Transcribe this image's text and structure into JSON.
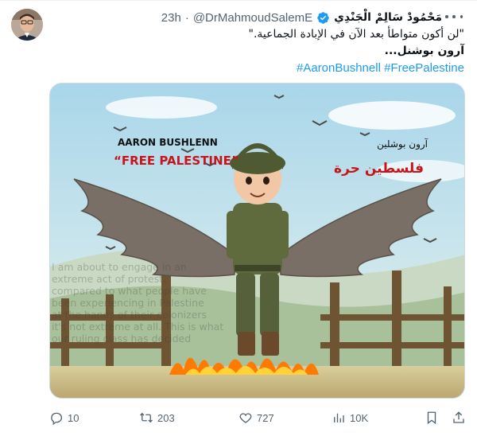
{
  "tweet": {
    "display_name": "مَحْمُودْ سَالِمْ الْجَنْدِي",
    "handle": "@DrMahmoudSalemE",
    "separator": "·",
    "time": "23h",
    "text_line1": "\"لن أكون متواطأ بعد الآن في الإبادة الجماعية.\"",
    "text_line2": "آرون بوشنل...",
    "hashtag1": "#FreePalestine",
    "hashtag2": "#AaronBushnell"
  },
  "image": {
    "english_name": "AARON BUSHLENN",
    "english_slogan": "“FREE   PALESTINE”",
    "arabic_name": "آرون بوشلين",
    "arabic_slogan": "فلسطين حرة",
    "overlay_text": [
      "I am about to engage in an",
      "extreme act of protest.",
      "compared to what people have",
      "been experiencing in Palestine",
      "at the hands of their colonizers",
      "it's not extreme at all. This is what",
      "our ruling class has decided"
    ]
  },
  "actions": {
    "replies": "10",
    "reposts": "203",
    "likes": "727",
    "views": "10K"
  },
  "colors": {
    "link": "#1d9bf0",
    "secondary": "#536471",
    "verified": "#1d9bf0",
    "fire": "#ff7a00"
  }
}
